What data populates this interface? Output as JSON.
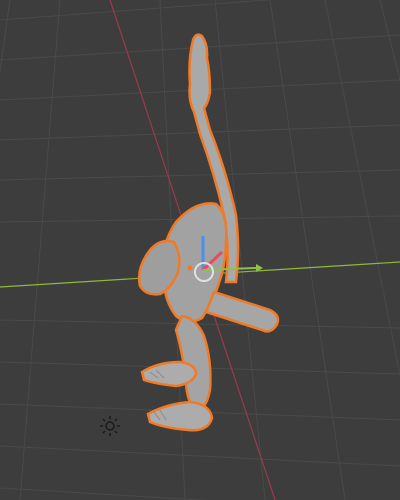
{
  "viewport": {
    "background_color": "#3d3d3d",
    "grid_color": "#4a4a4a",
    "x_axis_color": "#8fb83a",
    "y_axis_color": "#9b3b48",
    "selection_outline_color": "#f07a26",
    "mesh_color": "#a9a9a9"
  },
  "scene": {
    "selected_object": "sculpted-figure",
    "selected": true,
    "gizmo": {
      "x_arrow_color": "#8bc34a",
      "y_arrow_color": "#e84a5f",
      "z_arrow_color": "#4a8fe8"
    },
    "icons": {
      "object_origin": "origin-dot-icon",
      "transform_pivot": "pivot-circle-icon",
      "light_object": "sun-light-icon"
    }
  }
}
